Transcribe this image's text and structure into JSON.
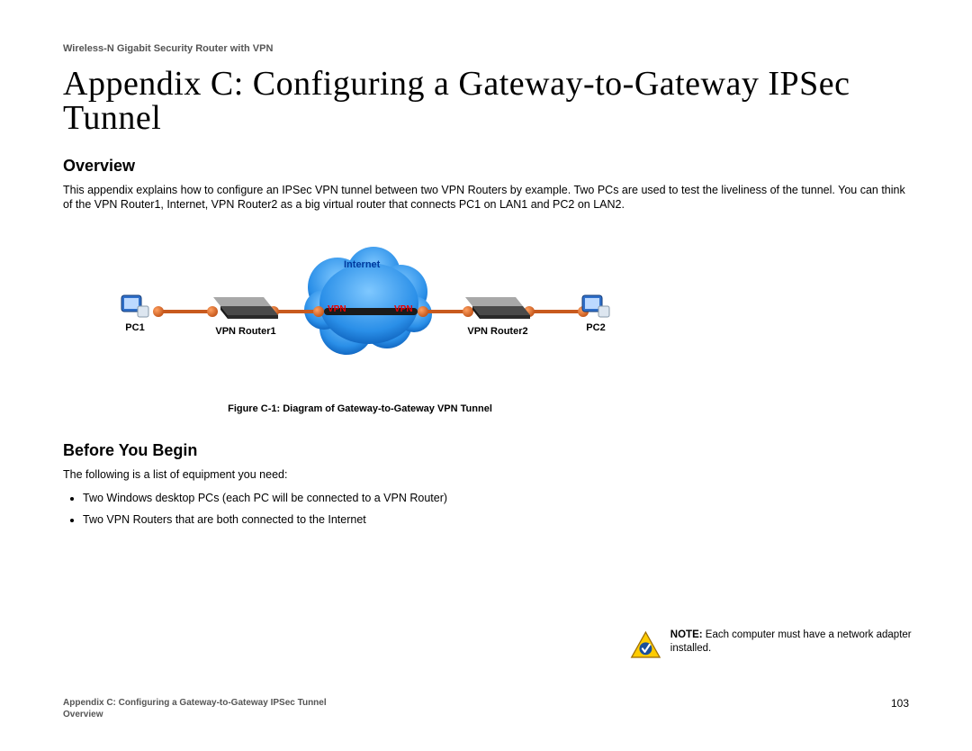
{
  "header": "Wireless-N Gigabit Security Router with VPN",
  "title": "Appendix C: Configuring a Gateway-to-Gateway IPSec Tunnel",
  "overview": {
    "heading": "Overview",
    "text": "This appendix explains how to configure an IPSec VPN tunnel between two VPN Routers by example. Two PCs are used to test the liveliness of the tunnel. You can think of the VPN Router1, Internet, VPN Router2 as a big virtual router that connects PC1 on LAN1 and PC2 on LAN2."
  },
  "diagram": {
    "internet": "Internet",
    "pc1": "PC1",
    "router1": "VPN Router1",
    "vpn_left": "VPN",
    "vpn_right": "VPN",
    "router2": "VPN Router2",
    "pc2": "PC2",
    "caption": "Figure C-1: Diagram of Gateway-to-Gateway VPN Tunnel"
  },
  "before": {
    "heading": "Before You Begin",
    "intro": "The following is a list of equipment you need:",
    "items": [
      "Two Windows desktop PCs (each PC will be connected to a VPN Router)",
      "Two VPN Routers that are both connected to the Internet"
    ]
  },
  "note": {
    "label": "NOTE:",
    "text": " Each computer must have a network adapter installed."
  },
  "footer": {
    "line1": "Appendix C: Configuring a Gateway-to-Gateway IPSec Tunnel",
    "line2": "Overview",
    "page": "103"
  }
}
